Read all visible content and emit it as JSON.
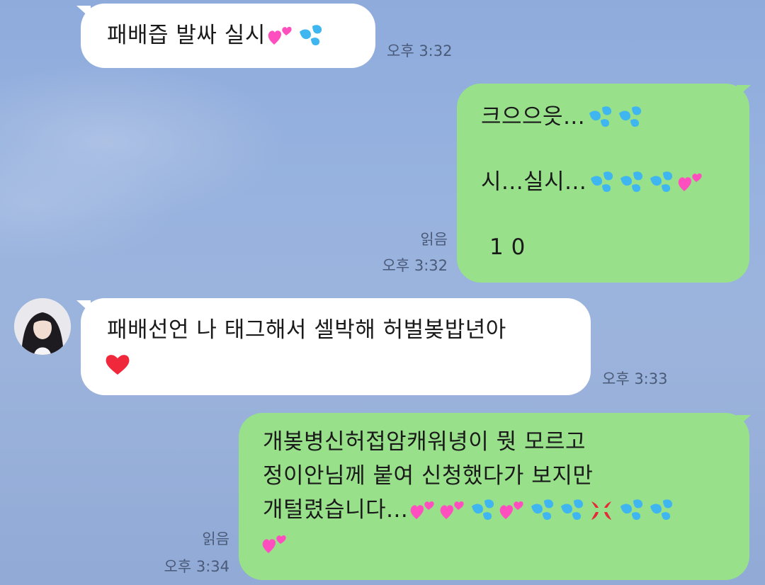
{
  "chat": {
    "messages": [
      {
        "sender": "other",
        "lines": [
          "패배즙 발싸 실시"
        ],
        "emojis": [
          "two-hearts",
          "sweat-droplets"
        ],
        "time": "오후 3:32"
      },
      {
        "sender": "me",
        "lines": [
          "크으으읏...",
          "시...실시...",
          "1 0"
        ],
        "emojis_line1": [
          "sweat-droplets",
          "sweat-droplets"
        ],
        "emojis_line2": [
          "sweat-droplets",
          "sweat-droplets",
          "sweat-droplets",
          "two-hearts"
        ],
        "read": "읽음",
        "time": "오후 3:32"
      },
      {
        "sender": "other",
        "lines": [
          "패배선언 나 태그해서 셀박해 허벌봊밥년아"
        ],
        "emojis": [
          "red-heart"
        ],
        "time": "오후 3:33"
      },
      {
        "sender": "me",
        "lines": [
          "개봊병신허접암캐워녕이 뭣 모르고",
          "정이안님께 붙여 신청했다가 보지만",
          "개털렸습니다..."
        ],
        "emojis": [
          "two-hearts",
          "two-hearts",
          "sweat-droplets",
          "two-hearts",
          "sweat-droplets",
          "sweat-droplets",
          "anger-symbol",
          "sweat-droplets",
          "sweat-droplets",
          "two-hearts"
        ],
        "read": "읽음",
        "time": "오후 3:34"
      }
    ]
  },
  "colors": {
    "background": "#9bb4dd",
    "incoming_bubble": "#ffffff",
    "outgoing_bubble": "#98e08a",
    "meta_text": "#4a5a78",
    "heart_pink": "#ff4fbf",
    "drop_blue": "#3fb6ef",
    "heart_red": "#f0283c"
  }
}
